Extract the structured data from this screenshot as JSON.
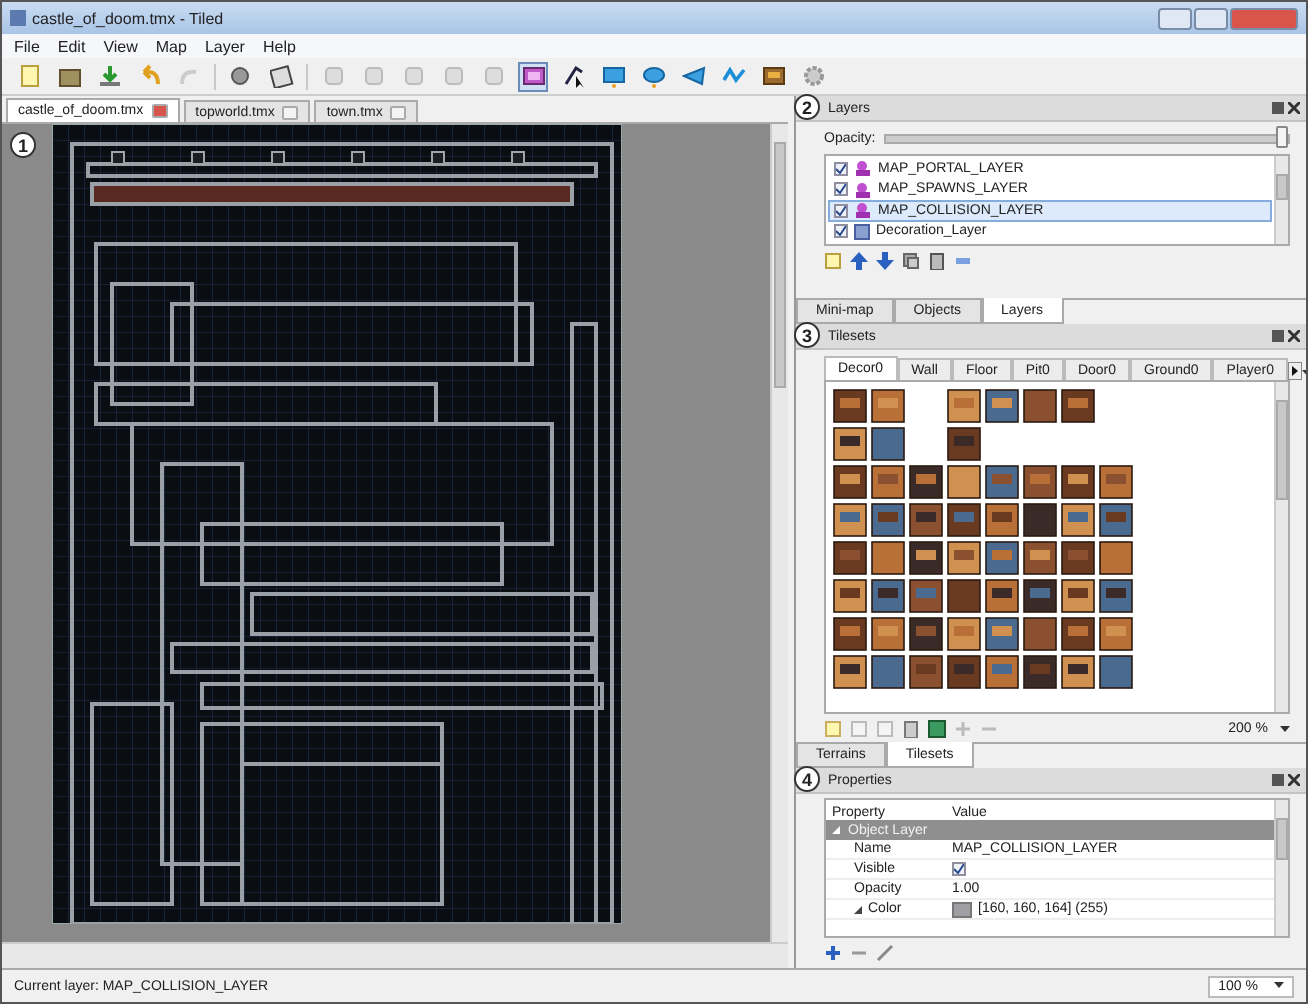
{
  "window": {
    "title": "castle_of_doom.tmx - Tiled"
  },
  "menu": [
    "File",
    "Edit",
    "View",
    "Map",
    "Layer",
    "Help"
  ],
  "tools": [
    {
      "kind": "stamp",
      "selected": true
    },
    {
      "kind": "select",
      "selected": false
    },
    {
      "kind": "rect",
      "selected": false
    },
    {
      "kind": "ellipse",
      "selected": false
    },
    {
      "kind": "polygon",
      "selected": false
    },
    {
      "kind": "polyline",
      "selected": false
    },
    {
      "kind": "tile",
      "selected": false
    }
  ],
  "document_tabs": [
    {
      "label": "castle_of_doom.tmx",
      "selected": true
    },
    {
      "label": "topworld.tmx",
      "selected": false
    },
    {
      "label": "town.tmx",
      "selected": false
    }
  ],
  "map": {
    "callout": "1"
  },
  "layers_panel": {
    "callout": "2",
    "title": "Layers",
    "opacity_label": "Opacity:",
    "opacity": {
      "level": 1
    },
    "layers": [
      {
        "name": "MAP_PORTAL_LAYER",
        "kind": "object",
        "visible": true,
        "selected": false
      },
      {
        "name": "MAP_SPAWNS_LAYER",
        "kind": "object",
        "visible": true,
        "selected": false
      },
      {
        "name": "MAP_COLLISION_LAYER",
        "kind": "object",
        "visible": true,
        "selected": true
      },
      {
        "name": "Decoration_Layer",
        "kind": "tile",
        "visible": true,
        "selected": false
      }
    ],
    "tabs": [
      {
        "label": "Mini-map",
        "selected": false
      },
      {
        "label": "Objects",
        "selected": false
      },
      {
        "label": "Layers",
        "selected": true
      }
    ]
  },
  "tilesets_panel": {
    "callout": "3",
    "title": "Tilesets",
    "tabs": [
      {
        "label": "Decor0",
        "selected": true
      },
      {
        "label": "Wall",
        "selected": false
      },
      {
        "label": "Floor",
        "selected": false
      },
      {
        "label": "Pit0",
        "selected": false
      },
      {
        "label": "Door0",
        "selected": false
      },
      {
        "label": "Ground0",
        "selected": false
      },
      {
        "label": "Player0",
        "selected": false
      }
    ],
    "zoom": "200 %",
    "tabs_bottom": [
      {
        "label": "Terrains",
        "selected": false
      },
      {
        "label": "Tilesets",
        "selected": true
      }
    ]
  },
  "properties_panel": {
    "callout": "4",
    "title": "Properties",
    "columns": [
      "Property",
      "Value"
    ],
    "group": "Object Layer",
    "rows": [
      {
        "name": "Name",
        "kind": "text",
        "value": "MAP_COLLISION_LAYER"
      },
      {
        "name": "Visible",
        "kind": "checkbox",
        "checked": true
      },
      {
        "name": "Opacity",
        "kind": "text",
        "value": "1.00"
      },
      {
        "name": "Color",
        "kind": "color",
        "value": "[160, 160, 164] (255)",
        "color": "#a0a0a4"
      }
    ]
  },
  "status_bar": {
    "text": "Current layer: MAP_COLLISION_LAYER",
    "zoom": "100 %"
  }
}
